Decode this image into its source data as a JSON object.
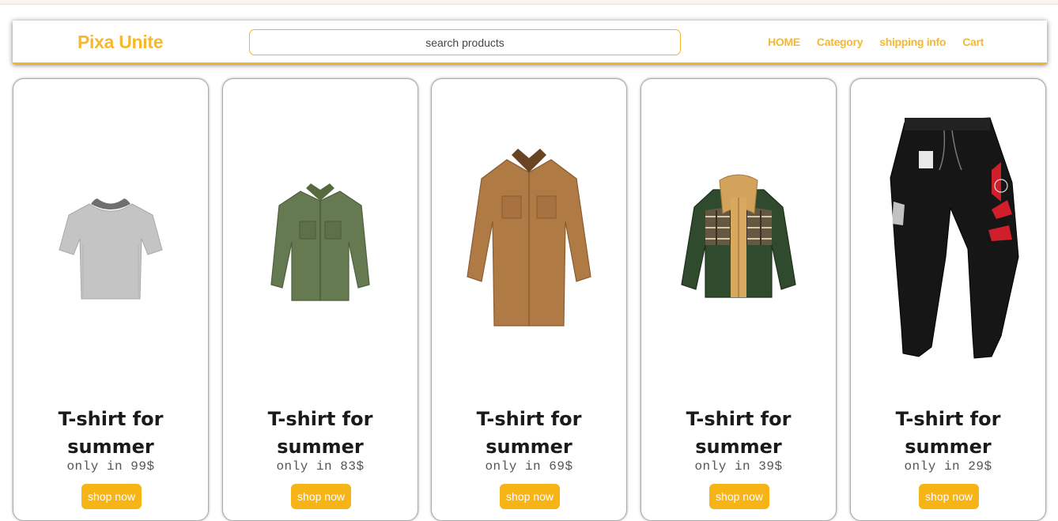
{
  "header": {
    "logo": "Pixa Unite",
    "search_placeholder": "search products",
    "nav": [
      "HOME",
      "Category",
      "shipping info",
      "Cart"
    ]
  },
  "products": [
    {
      "title_line1": "T-shirt for",
      "title_line2": "summer",
      "price": "only in 99$",
      "button": "shop now",
      "image": "grey-tshirt"
    },
    {
      "title_line1": "T-shirt for",
      "title_line2": "summer",
      "price": "only in 83$",
      "button": "shop now",
      "image": "olive-shirt"
    },
    {
      "title_line1": "T-shirt for",
      "title_line2": "summer",
      "price": "only in 69$",
      "button": "shop now",
      "image": "brown-corduroy-shirt"
    },
    {
      "title_line1": "T-shirt for",
      "title_line2": "summer",
      "price": "only in 39$",
      "button": "shop now",
      "image": "plaid-hooded-jacket"
    },
    {
      "title_line1": "T-shirt for",
      "title_line2": "summer",
      "price": "only in 29$",
      "button": "shop now",
      "image": "black-cargo-pants"
    }
  ],
  "colors": {
    "accent": "#f5b82e",
    "button": "#f7b416"
  }
}
